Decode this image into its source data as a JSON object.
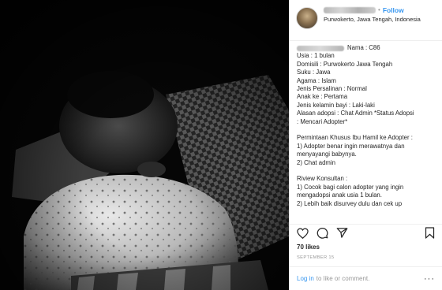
{
  "post": {
    "follow_label": "Follow",
    "location": "Purwokerto, Jawa Tengah, Indonesia",
    "caption_first": "Nama : C86",
    "caption_lines": [
      "Usia : 1 bulan",
      "Domisili : Purwokerto Jawa Tengah",
      "Suku : Jawa",
      "Agama : Islam",
      "Jenis Persalinan : Normal",
      "Anak ke : Pertama",
      "Jenis kelamin bayi : Laki-laki",
      "Alasan adopsi : Chat Admin *Status Adopsi",
      ": Mencari Adopter*",
      "",
      "Permintaan Khusus Ibu Hamil ke Adopter :",
      "1) Adopter benar ingin merawatnya dan",
      "menyayangi babynya.",
      "2) Chat admin",
      "",
      "Riview Konsultan :",
      "1) Cocok bagi calon adopter yang ingin",
      "mengadopsi anak usia 1 bulan.",
      "2) Lebih baik disurvey dulu dan cek up"
    ],
    "likes": "70 likes",
    "date": "SEPTEMBER 15",
    "login_link": "Log in",
    "login_rest": "to like or comment.",
    "more": "···"
  },
  "icons": {
    "like": "heart-icon",
    "comment": "comment-icon",
    "share": "share-icon",
    "save": "bookmark-icon",
    "more": "more-options-icon"
  },
  "colors": {
    "link_blue": "#3897f0",
    "muted_text": "#999999",
    "photo_background": "#050505"
  }
}
